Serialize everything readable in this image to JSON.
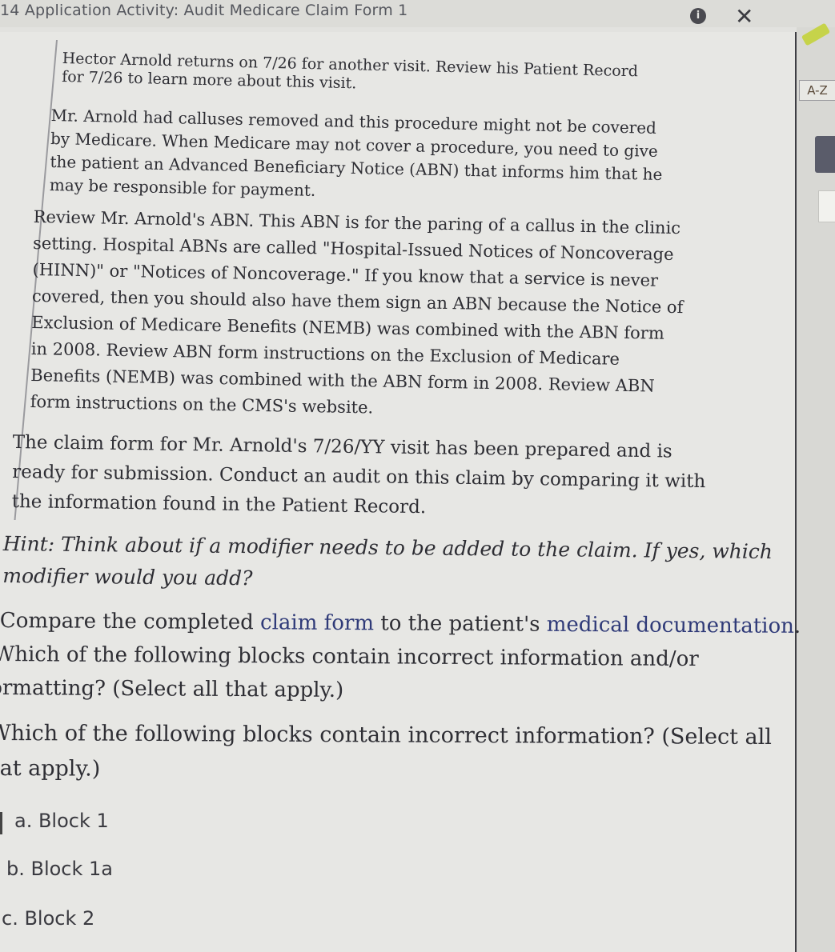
{
  "header": {
    "title": "14 Application Activity: Audit Medicare Claim Form 1",
    "info_icon": "info-icon",
    "close_icon": "close-icon",
    "close_glyph": "✕",
    "info_glyph": "i"
  },
  "sidebar": {
    "pencil_icon": "pencil-icon",
    "glossary_label": "A-Z"
  },
  "content": {
    "p1_line1": "Hector Arnold returns on 7/26 for another visit. Review his Patient Record",
    "p1_line2": "for 7/26 to learn more about this visit.",
    "p2_line1": "Mr. Arnold had calluses removed and this procedure might not be covered",
    "p2_line2": "by Medicare. When Medicare may not cover a procedure, you need to give",
    "p2_line3": "the patient an Advanced Beneficiary Notice (ABN) that informs him that he",
    "p2_line4": "may be responsible for payment.",
    "p3_line1": "Review Mr. Arnold's ABN. This ABN is for the paring of a callus in the clinic",
    "p3_line2": "setting. Hospital ABNs are called \"Hospital-Issued Notices of Noncoverage",
    "p3_line3": "(HINN)\" or \"Notices of Noncoverage.\" If you know that a service is never",
    "p3_line4": "covered, then you should also have them sign an ABN because the Notice of",
    "p3_line5": "Exclusion of Medicare Benefits (NEMB) was combined with the ABN form",
    "p3_line6": "in 2008. Review ABN form instructions on the Exclusion of Medicare",
    "p3_line7": "Benefits (NEMB) was combined with the ABN form in 2008. Review ABN",
    "p3_line8": "form instructions on the CMS's website.",
    "p4_line1": "The claim form for Mr. Arnold's 7/26/YY visit has been prepared and is",
    "p4_line2": "ready for submission. Conduct an audit on this claim by comparing it with",
    "p4_line3": "the information found in the Patient Record.",
    "p5_line1": "Hint: Think about if a modifier needs to be added to the claim. If yes, which",
    "p5_line2": "modifier would you add?",
    "p6_line1_pre": "Compare the completed ",
    "p6_link1": "claim form",
    "p6_line1_mid": " to the patient's ",
    "p6_link2": "medical documentation",
    "p6_line1_post": ".",
    "p6_line2": "Which of the following blocks contain incorrect information and/or",
    "p6_line3": "ormatting? (Select all that apply.)",
    "p7_line1": "Which of the following blocks contain incorrect information? (Select all",
    "p7_line2": "at apply.)"
  },
  "options": [
    {
      "label": "a. Block 1"
    },
    {
      "label": "b. Block 1a"
    },
    {
      "label": "c. Block 2"
    }
  ],
  "colors": {
    "link": "#2f3a78",
    "pencil": "#c6d34a"
  }
}
